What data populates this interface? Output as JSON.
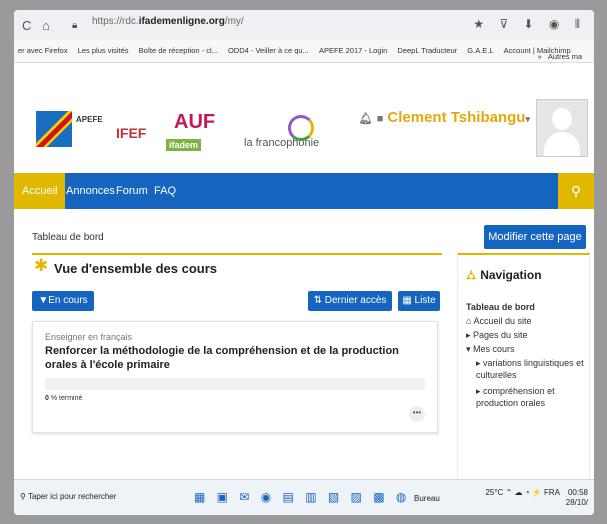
{
  "browser": {
    "back": "C",
    "home": "⌂",
    "url_prefix": "https://rdc.",
    "url_domain": "ifademenligne.org",
    "url_suffix": "/my/",
    "bookmarks": [
      "er avec Firefox",
      "Les plus visités",
      "Boîte de réception - cl...",
      "ODD4 - Veiller à ce qu...",
      "APEFE 2017 - Login",
      "DeepL Traducteur",
      "G.A.E.L",
      "Account | Mailchimp"
    ],
    "bookmarks_more": "Autres ma"
  },
  "header": {
    "logos": {
      "apefe": "APEFE",
      "ifef": "IFEF",
      "auf": "AUF",
      "ifadem": "ifadem",
      "francophonie": "la francophonie"
    },
    "user_name": "Clement Tshibangu",
    "user_chevron": "▾"
  },
  "nav": {
    "items": [
      "Accueil",
      "Annonces",
      "Forum",
      "FAQ"
    ]
  },
  "page": {
    "breadcrumb": "Tableau de bord",
    "modify_button": "Modifier cette page"
  },
  "overview": {
    "title": "Vue d'ensemble des cours",
    "filter_button": "En cours",
    "sort_button": "Dernier accès",
    "view_button": "Liste",
    "course": {
      "category": "Enseigner en français",
      "title": "Renforcer la méthodologie de la compréhension et de la production orales à l'école primaire",
      "progress_value": "0",
      "progress_text": "% terminé",
      "progress_fraction": 0
    }
  },
  "navigation": {
    "title": "Navigation",
    "dashboard": "Tableau de bord",
    "home": "Accueil du site",
    "pages": "Pages du site",
    "my_courses": "Mes cours",
    "course1": "variations linguistiques et culturelles",
    "course2": "compréhension et production orales"
  },
  "taskbar": {
    "search": "Taper ici pour rechercher",
    "desktop": "Bureau",
    "temperature": "25°C",
    "language": "FRA",
    "time": "00:58",
    "date": "28/10/"
  }
}
